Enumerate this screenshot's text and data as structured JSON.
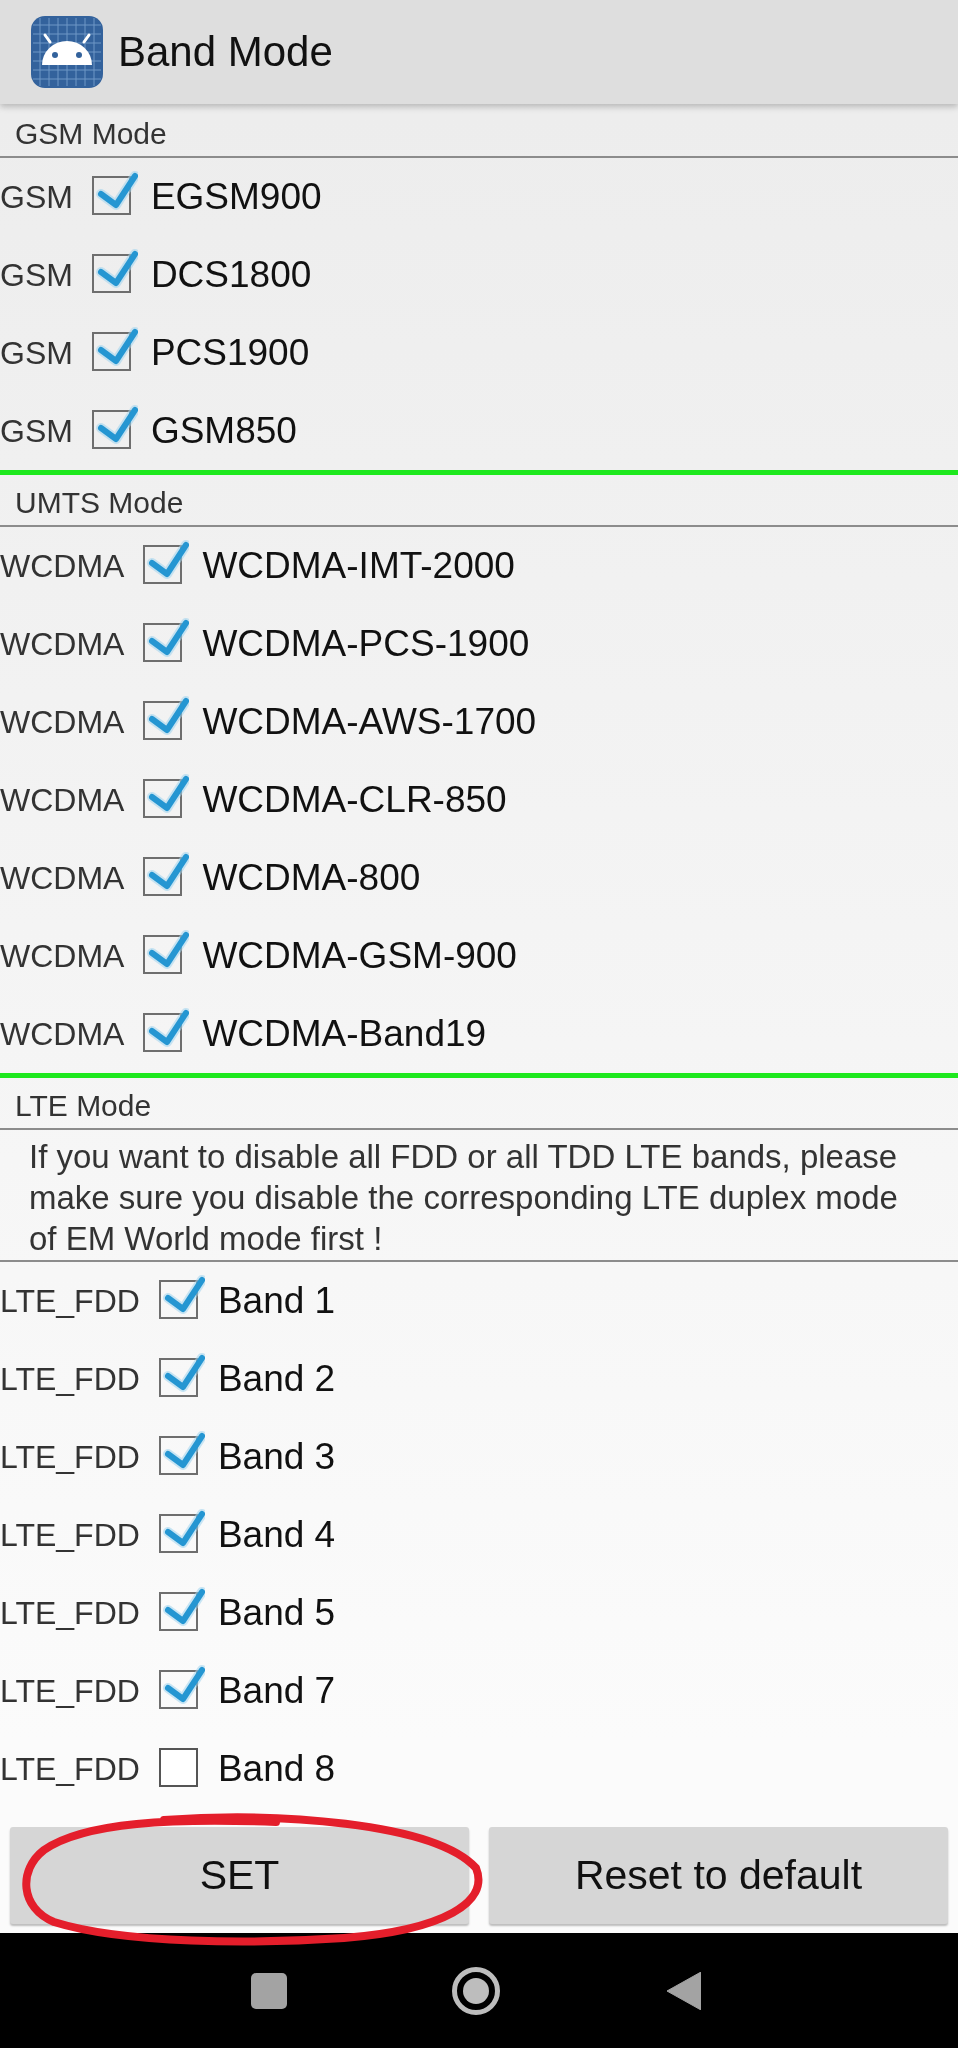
{
  "app_bar": {
    "title": "Band Mode"
  },
  "sections": [
    {
      "title": "GSM Mode",
      "bands": [
        {
          "type": "GSM",
          "name": "EGSM900",
          "checked": true
        },
        {
          "type": "GSM",
          "name": "DCS1800",
          "checked": true
        },
        {
          "type": "GSM",
          "name": "PCS1900",
          "checked": true
        },
        {
          "type": "GSM",
          "name": "GSM850",
          "checked": true
        }
      ]
    },
    {
      "title": "UMTS Mode",
      "bands": [
        {
          "type": "WCDMA",
          "name": "WCDMA-IMT-2000",
          "checked": true
        },
        {
          "type": "WCDMA",
          "name": "WCDMA-PCS-1900",
          "checked": true
        },
        {
          "type": "WCDMA",
          "name": "WCDMA-AWS-1700",
          "checked": true
        },
        {
          "type": "WCDMA",
          "name": "WCDMA-CLR-850",
          "checked": true
        },
        {
          "type": "WCDMA",
          "name": "WCDMA-800",
          "checked": true
        },
        {
          "type": "WCDMA",
          "name": "WCDMA-GSM-900",
          "checked": true
        },
        {
          "type": "WCDMA",
          "name": "WCDMA-Band19",
          "checked": true
        }
      ]
    },
    {
      "title": "LTE Mode",
      "note": "If you want to disable all FDD or all TDD LTE bands, please make sure you disable the corresponding LTE duplex mode of EM World mode first !",
      "bands": [
        {
          "type": "LTE_FDD",
          "name": "Band 1",
          "checked": true
        },
        {
          "type": "LTE_FDD",
          "name": "Band 2",
          "checked": true
        },
        {
          "type": "LTE_FDD",
          "name": "Band 3",
          "checked": true
        },
        {
          "type": "LTE_FDD",
          "name": "Band 4",
          "checked": true
        },
        {
          "type": "LTE_FDD",
          "name": "Band 5",
          "checked": true
        },
        {
          "type": "LTE_FDD",
          "name": "Band 7",
          "checked": true
        },
        {
          "type": "LTE_FDD",
          "name": "Band 8",
          "checked": false
        }
      ]
    }
  ],
  "buttons": [
    {
      "label": "SET",
      "circled": true
    },
    {
      "label": "Reset to default",
      "circled": false
    }
  ]
}
